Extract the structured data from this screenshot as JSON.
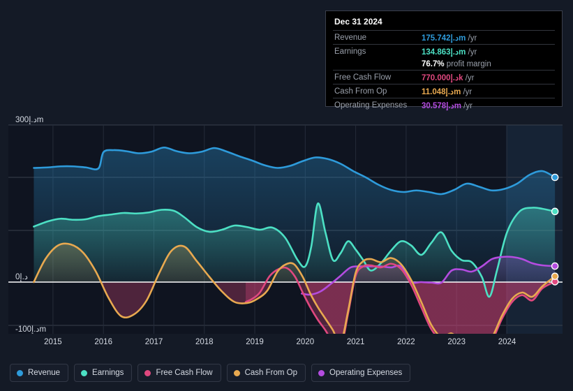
{
  "chart_data": {
    "type": "area",
    "title": "",
    "xlabel": "",
    "ylabel": "",
    "currency_unit": "د.إ",
    "grid": true,
    "legend_position": "bottom",
    "ylim": [
      -140,
      340
    ],
    "yticks": [
      {
        "value": 300,
        "label": "300د.إm"
      },
      {
        "value": 0,
        "label": "0د.إ"
      },
      {
        "value": -100,
        "label": "-100د.إm"
      }
    ],
    "xticks": [
      "2015",
      "2016",
      "2017",
      "2018",
      "2019",
      "2020",
      "2021",
      "2022",
      "2023",
      "2024"
    ],
    "xlim": [
      "2014.6",
      "2025.1"
    ],
    "series": [
      {
        "name": "Revenue",
        "color": "#2e9bdb",
        "x": [
          2014.62,
          2014.9,
          2015.15,
          2015.4,
          2015.65,
          2015.9,
          2016.0,
          2016.2,
          2016.45,
          2016.7,
          2016.95,
          2017.2,
          2017.45,
          2017.7,
          2017.95,
          2018.2,
          2018.45,
          2018.7,
          2018.95,
          2019.2,
          2019.45,
          2019.7,
          2019.95,
          2020.2,
          2020.45,
          2020.7,
          2020.95,
          2021.2,
          2021.45,
          2021.7,
          2021.95,
          2022.2,
          2022.45,
          2022.7,
          2022.95,
          2023.2,
          2023.45,
          2023.7,
          2023.95,
          2024.2,
          2024.45,
          2024.7,
          2024.95
        ],
        "y": [
          218,
          219,
          221,
          221,
          219,
          217,
          248,
          252,
          250,
          246,
          249,
          257,
          250,
          246,
          249,
          256,
          249,
          240,
          232,
          223,
          218,
          222,
          231,
          238,
          235,
          226,
          212,
          200,
          186,
          176,
          172,
          175,
          172,
          168,
          176,
          188,
          182,
          175,
          178,
          188,
          205,
          212,
          200
        ],
        "end_value": 175.742,
        "end_value_display": "175.742د.إm"
      },
      {
        "name": "Earnings",
        "color": "#4ce0c4",
        "x": [
          2014.62,
          2014.9,
          2015.15,
          2015.4,
          2015.65,
          2015.9,
          2016.15,
          2016.4,
          2016.65,
          2016.9,
          2017.15,
          2017.4,
          2017.6,
          2017.85,
          2018.1,
          2018.35,
          2018.6,
          2018.85,
          2019.1,
          2019.35,
          2019.6,
          2019.85,
          2020.0,
          2020.12,
          2020.25,
          2020.4,
          2020.55,
          2020.7,
          2020.85,
          2021.0,
          2021.15,
          2021.3,
          2021.5,
          2021.7,
          2021.9,
          2022.1,
          2022.3,
          2022.5,
          2022.7,
          2022.9,
          2023.1,
          2023.3,
          2023.5,
          2023.65,
          2023.8,
          2024.0,
          2024.25,
          2024.5,
          2024.7,
          2024.95
        ],
        "y": [
          106,
          116,
          121,
          119,
          120,
          126,
          129,
          132,
          131,
          133,
          138,
          136,
          124,
          105,
          96,
          100,
          108,
          105,
          100,
          104,
          85,
          42,
          30,
          68,
          150,
          95,
          42,
          55,
          78,
          62,
          42,
          22,
          36,
          60,
          78,
          70,
          52,
          75,
          95,
          60,
          42,
          38,
          10,
          -28,
          22,
          95,
          135,
          142,
          140,
          134.863
        ],
        "end_value": 134.863,
        "end_value_display": "134.863د.إm"
      },
      {
        "name": "Free Cash Flow",
        "color": "#e0487f",
        "x": [
          2018.82,
          2018.95,
          2019.1,
          2019.3,
          2019.5,
          2019.65,
          2019.8,
          2019.95,
          2020.1,
          2020.25,
          2020.4,
          2020.55,
          2020.7,
          2020.85,
          2021.0,
          2021.15,
          2021.3,
          2021.5,
          2021.7,
          2021.9,
          2022.1,
          2022.3,
          2022.5,
          2022.7,
          2022.9,
          2023.1,
          2023.3,
          2023.5,
          2023.7,
          2023.9,
          2024.1,
          2024.3,
          2024.5,
          2024.7,
          2024.95
        ],
        "y": [
          -38,
          -32,
          -20,
          12,
          26,
          26,
          10,
          -20,
          -48,
          -72,
          -92,
          -116,
          -128,
          -60,
          12,
          30,
          32,
          28,
          35,
          25,
          -5,
          -48,
          -90,
          -110,
          -104,
          -118,
          -112,
          -128,
          -112,
          -70,
          -38,
          -25,
          -35,
          -12,
          0.77
        ],
        "end_value": 0.77,
        "end_value_display": "770.000د.إk"
      },
      {
        "name": "Cash From Op",
        "color": "#e8a950",
        "x": [
          2014.62,
          2014.85,
          2015.1,
          2015.35,
          2015.6,
          2015.85,
          2016.1,
          2016.35,
          2016.6,
          2016.85,
          2017.1,
          2017.35,
          2017.6,
          2017.85,
          2018.1,
          2018.35,
          2018.6,
          2018.85,
          2019.05,
          2019.25,
          2019.45,
          2019.62,
          2019.78,
          2019.95,
          2020.1,
          2020.25,
          2020.4,
          2020.55,
          2020.7,
          2020.85,
          2021.0,
          2021.15,
          2021.3,
          2021.5,
          2021.7,
          2021.9,
          2022.1,
          2022.3,
          2022.5,
          2022.7,
          2022.9,
          2023.1,
          2023.3,
          2023.5,
          2023.7,
          2023.9,
          2024.1,
          2024.3,
          2024.5,
          2024.7,
          2024.95
        ],
        "y": [
          0,
          44,
          70,
          72,
          56,
          20,
          -30,
          -65,
          -62,
          -36,
          16,
          60,
          68,
          40,
          10,
          -18,
          -38,
          -40,
          -32,
          -16,
          20,
          34,
          34,
          10,
          -22,
          -48,
          -70,
          -92,
          -118,
          -55,
          18,
          40,
          44,
          38,
          46,
          34,
          4,
          -38,
          -82,
          -105,
          -98,
          -112,
          -106,
          -122,
          -106,
          -64,
          -32,
          -20,
          -28,
          -8,
          11.048
        ],
        "end_value": 11.048,
        "end_value_display": "11.048د.إm"
      },
      {
        "name": "Operating Expenses",
        "color": "#b44ce0",
        "x": [
          2019.93,
          2020.1,
          2020.3,
          2020.5,
          2020.7,
          2020.9,
          2021.1,
          2021.3,
          2021.5,
          2021.7,
          2021.9,
          2022.1,
          2022.3,
          2022.5,
          2022.7,
          2022.9,
          2023.1,
          2023.3,
          2023.5,
          2023.7,
          2023.9,
          2024.1,
          2024.3,
          2024.5,
          2024.7,
          2024.95
        ],
        "y": [
          -22,
          -24,
          -18,
          -4,
          12,
          28,
          30,
          30,
          30,
          28,
          30,
          1,
          0,
          -1,
          -1,
          22,
          24,
          20,
          30,
          44,
          48,
          48,
          44,
          36,
          32,
          30.578
        ],
        "end_value": 30.578,
        "end_value_display": "30.578د.إm"
      }
    ],
    "highlight_band": {
      "from": 2023.98,
      "to": 2025.1,
      "label": ""
    }
  },
  "tooltip": {
    "date": "Dec 31 2024",
    "rows": [
      {
        "label": "Revenue",
        "value": "175.742",
        "unit": "د.إm",
        "suffix": "/yr",
        "color_key": "v-rev"
      },
      {
        "label": "Earnings",
        "value": "134.863",
        "unit": "د.إm",
        "suffix": "/yr",
        "color_key": "v-ear"
      },
      {
        "label": "",
        "value": "76.7%",
        "unit": "",
        "suffix": "profit margin",
        "color_key": "v-pm"
      },
      {
        "label": "Free Cash Flow",
        "value": "770.000",
        "unit": "د.إk",
        "suffix": "/yr",
        "color_key": "v-fcf"
      },
      {
        "label": "Cash From Op",
        "value": "11.048",
        "unit": "د.إm",
        "suffix": "/yr",
        "color_key": "v-cfo"
      },
      {
        "label": "Operating Expenses",
        "value": "30.578",
        "unit": "د.إm",
        "suffix": "/yr",
        "color_key": "v-opex"
      }
    ]
  },
  "legend": {
    "items": [
      {
        "label": "Revenue",
        "color": "#2e9bdb"
      },
      {
        "label": "Earnings",
        "color": "#4ce0c4"
      },
      {
        "label": "Free Cash Flow",
        "color": "#e0487f"
      },
      {
        "label": "Cash From Op",
        "color": "#e8a950"
      },
      {
        "label": "Operating Expenses",
        "color": "#b44ce0"
      }
    ]
  }
}
